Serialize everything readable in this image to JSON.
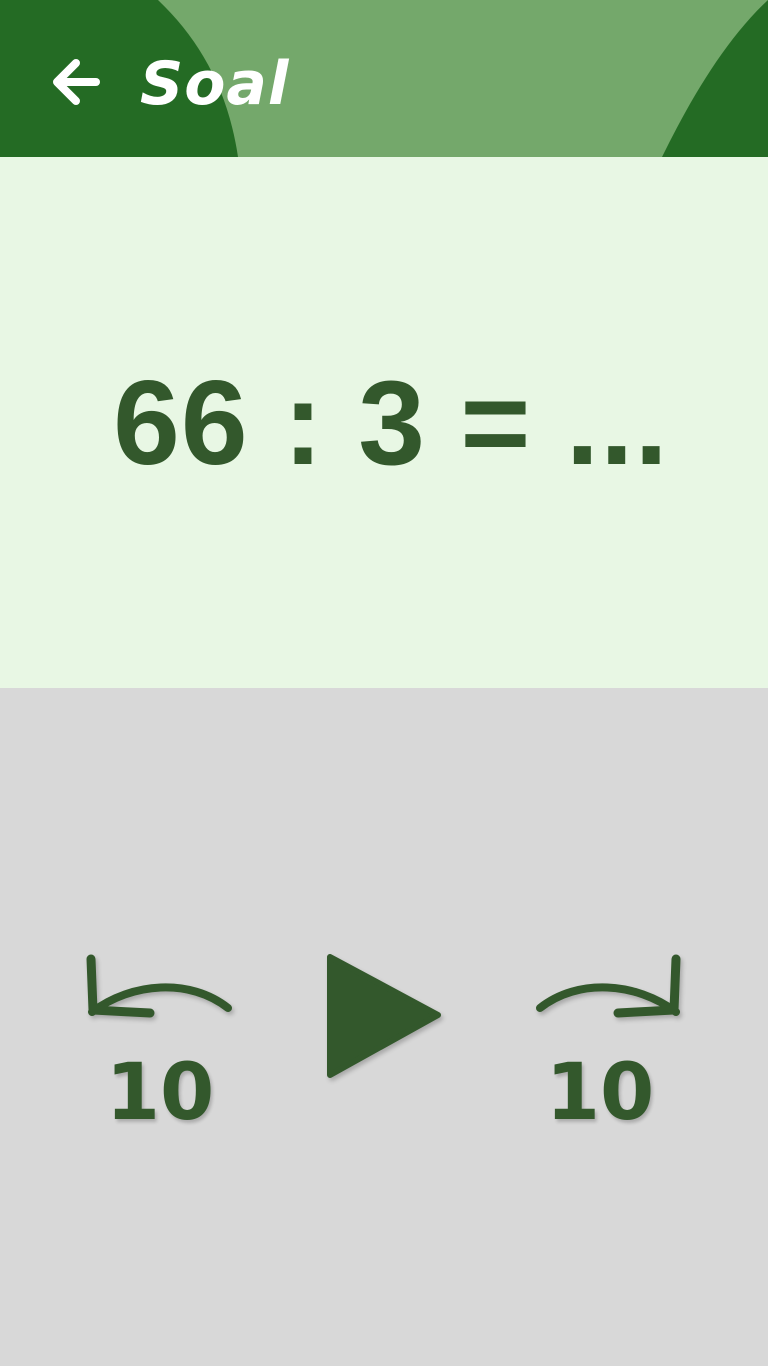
{
  "header": {
    "title": "Soal",
    "back_icon": "arrow-left-icon",
    "colors": {
      "base": "#74a86b",
      "dark": "#246b24",
      "text": "#ffffff"
    }
  },
  "question": {
    "text": "66 : 3 = ...",
    "color": "#33582c",
    "background": "#e8f7e4"
  },
  "controls": {
    "rewind": {
      "icon": "rewind-arrow-icon",
      "label": "10"
    },
    "play": {
      "icon": "play-icon"
    },
    "forward": {
      "icon": "forward-arrow-icon",
      "label": "10"
    },
    "color": "#33582c",
    "background": "#d8d8d8"
  }
}
